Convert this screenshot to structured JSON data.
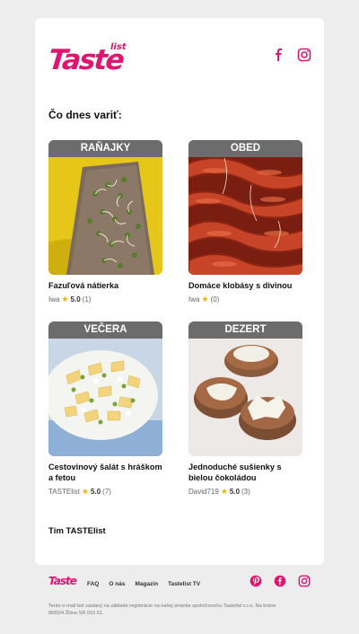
{
  "brand": {
    "logo_main": "Taste",
    "logo_sub": "list",
    "color": "#e0156f"
  },
  "header": {
    "title": "Čo dnes variť:"
  },
  "recipes": [
    {
      "category": "RAŇAJKY",
      "name": "Fazuľová nátierka",
      "author": "Iwa",
      "rating": "5.0",
      "count": "(1)"
    },
    {
      "category": "OBED",
      "name": "Domáce klobásy s divinou",
      "author": "Iwa",
      "rating": "",
      "count": "(0)"
    },
    {
      "category": "VEČERA",
      "name": "Cestovinový šalát s hráškom a fetou",
      "author": "TASTElist",
      "rating": "5.0",
      "count": "(7)"
    },
    {
      "category": "DEZERT",
      "name": "Jednoduché sušienky s bielou čokoládou",
      "author": "David719",
      "rating": "5.0",
      "count": "(3)"
    }
  ],
  "signoff": "Tím TASTElist",
  "footer": {
    "logo": "Taste",
    "nav": [
      "FAQ",
      "O nás",
      "Magazín",
      "Tastelist TV"
    ],
    "note": "Tento e-mail bol zaslaný na základe registrácie na našej stránke spoločnosťou Tastelist s.r.o. Na bráne 8665/4 Žilina SR 010 01."
  },
  "icons": {
    "facebook": "facebook-icon",
    "instagram": "instagram-icon",
    "pinterest": "pinterest-icon",
    "star": "star-icon"
  }
}
